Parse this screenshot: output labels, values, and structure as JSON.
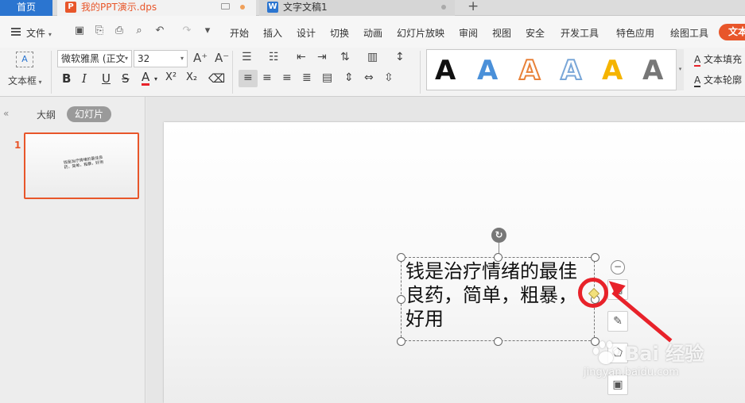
{
  "tabs": {
    "home": "首页",
    "ppt": {
      "title": "我的PPT演示.dps",
      "badge": "P"
    },
    "doc": {
      "title": "文字文稿1",
      "badge": "W"
    },
    "new": "+"
  },
  "menu": {
    "file": "文件",
    "items": [
      "开始",
      "插入",
      "设计",
      "切换",
      "动画",
      "幻灯片放映",
      "审阅",
      "视图",
      "安全",
      "开发工具",
      "特色应用",
      "绘图工具"
    ],
    "active": "文本"
  },
  "ribbon": {
    "textbox_label": "文本框",
    "textbox_icon": "A",
    "font_family": "微软雅黑 (正文",
    "font_size": "32",
    "grow_font": "A⁺",
    "shrink_font": "A⁻",
    "bold": "B",
    "italic": "I",
    "underline": "U",
    "strike": "S",
    "font_color": "A",
    "superscript": "X²",
    "subscript": "X₂",
    "text_fill": "文本填充",
    "text_outline": "文本轮廓"
  },
  "styles_gallery": [
    {
      "glyph": "A",
      "color": "#111111"
    },
    {
      "glyph": "A",
      "color": "#4a90d9"
    },
    {
      "glyph": "A",
      "color": "#e8823a"
    },
    {
      "glyph": "A",
      "color": "#7aa7d8"
    },
    {
      "glyph": "A",
      "color": "#f5b400"
    },
    {
      "glyph": "A",
      "color": "#777777"
    }
  ],
  "panel": {
    "collapse": "«",
    "outline_tab": "大纲",
    "slides_tab": "幻灯片",
    "slide_number": "1",
    "thumb_text": "钱是治疗情绪的最佳良药，简单，粗暴，好用"
  },
  "slide": {
    "text": "钱是治疗情绪的最佳良药，简单，粗暴，好用"
  },
  "watermark": {
    "brand": "Bai 经验",
    "url": "jingyan.baidu.com"
  },
  "colors": {
    "accent": "#e8562a",
    "home_tab": "#2b75d0",
    "annotation": "#e8222a"
  }
}
